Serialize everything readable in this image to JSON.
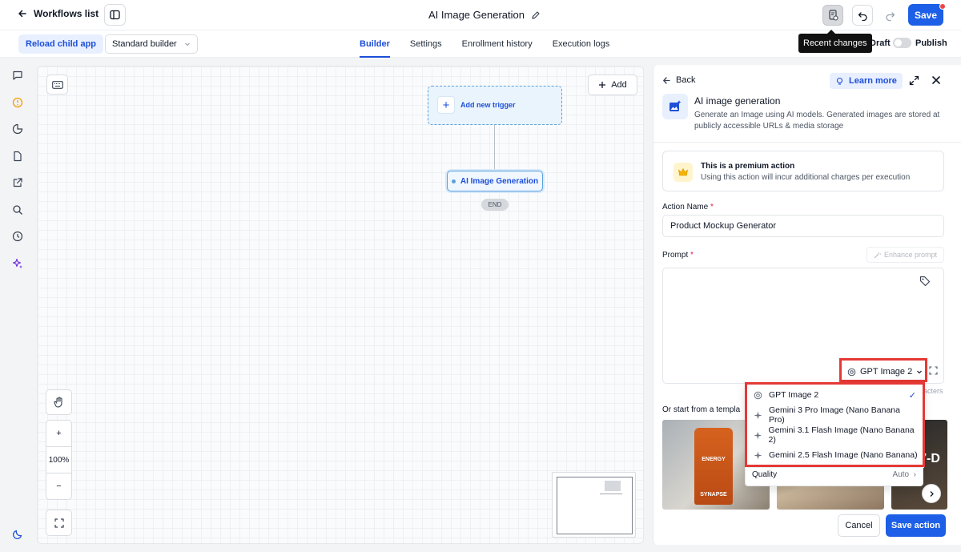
{
  "topbar": {
    "back_label": "Workflows list",
    "title": "AI Image Generation",
    "save_label": "Save"
  },
  "subbar": {
    "reload_label": "Reload child app",
    "builder_select": "Standard builder",
    "tabs": [
      {
        "label": "Builder",
        "active": true
      },
      {
        "label": "Settings"
      },
      {
        "label": "Enrollment history"
      },
      {
        "label": "Execution logs"
      }
    ],
    "tooltip": "Recent changes",
    "draft_label": "Draft",
    "publish_label": "Publish"
  },
  "canvas": {
    "add_label": "Add",
    "trigger_label": "Add new trigger",
    "node_label": "AI Image Generation",
    "end_label": "END",
    "zoom_in": "+",
    "zoom_level": "100%",
    "zoom_out": "−"
  },
  "panel": {
    "back_label": "Back",
    "learn_more": "Learn more",
    "title": "AI image generation",
    "description": "Generate an Image using AI models. Generated images are stored at publicly accessible URLs & media storage",
    "premium_title": "This is a premium action",
    "premium_sub": "Using this action will incur additional charges per execution",
    "action_name_label": "Action Name",
    "action_name_value": "Product Mockup Generator",
    "prompt_label": "Prompt",
    "enhance_label": "Enhance prompt",
    "selected_model": "GPT Image 2",
    "chars_label": "acters",
    "templates_label": "Or start from a templa",
    "cancel_label": "Cancel",
    "save_action_label": "Save action",
    "thumb1_text1": "ENERGY",
    "thumb1_text2": "SYNAPSE",
    "thumb3_text": "E 7-D"
  },
  "dropdown": {
    "items": [
      {
        "label": "GPT Image 2",
        "selected": true
      },
      {
        "label": "Gemini 3 Pro Image (Nano Banana Pro)"
      },
      {
        "label": "Gemini 3.1 Flash Image (Nano Banana 2)"
      },
      {
        "label": "Gemini 2.5 Flash Image (Nano Banana)"
      }
    ],
    "quality_label": "Quality",
    "quality_value": "Auto"
  },
  "colors": {
    "accent": "#1d5fe6",
    "highlight": "#e53935"
  }
}
